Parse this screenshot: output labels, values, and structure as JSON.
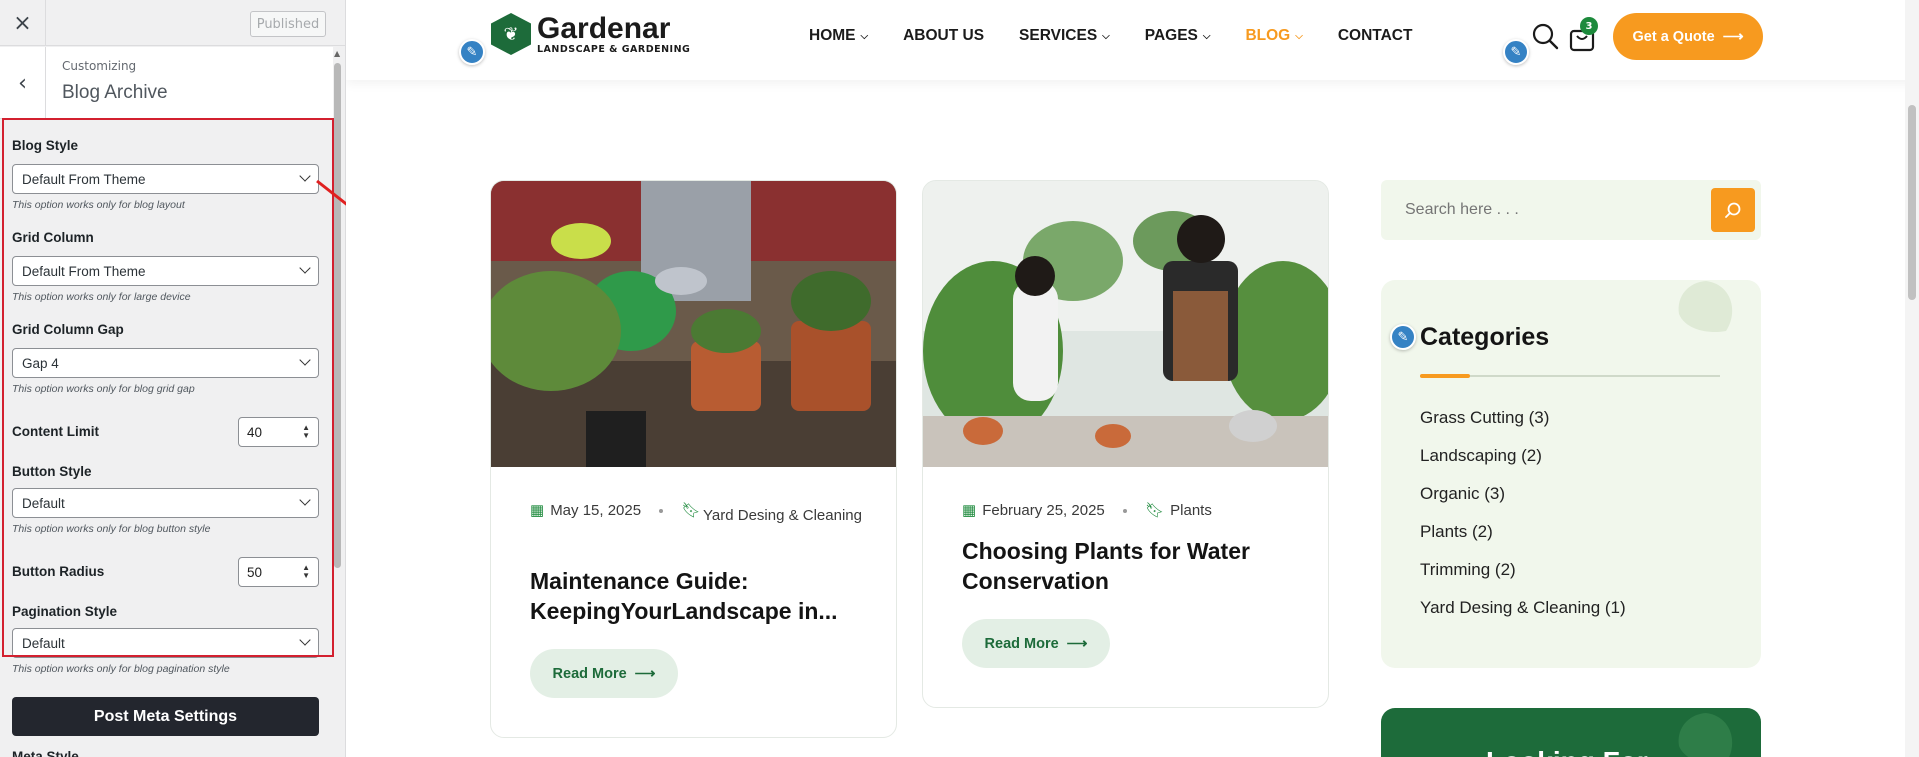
{
  "customizer": {
    "close_label": "×",
    "published_label": "Published",
    "breadcrumb": "Customizing",
    "section_title": "Blog Archive",
    "controls": {
      "blog_style": {
        "label": "Blog Style",
        "value": "Default From Theme",
        "hint": "This option works only for blog layout"
      },
      "grid_column": {
        "label": "Grid Column",
        "value": "Default From Theme",
        "hint": "This option works only for large device"
      },
      "grid_column_gap": {
        "label": "Grid Column Gap",
        "value": "Gap 4",
        "hint": "This option works only for blog grid gap"
      },
      "content_limit": {
        "label": "Content Limit",
        "value": "40"
      },
      "button_style": {
        "label": "Button Style",
        "value": "Default",
        "hint": "This option works only for blog button style"
      },
      "button_radius": {
        "label": "Button Radius",
        "value": "50"
      },
      "pagination_style": {
        "label": "Pagination Style",
        "value": "Default",
        "hint": "This option works only for blog pagination style"
      },
      "meta_style": {
        "label": "Meta Style"
      }
    },
    "post_meta_button": "Post Meta Settings"
  },
  "site": {
    "logo": {
      "name": "Gardenar",
      "tagline": "LANDSCAPE & GARDENING"
    },
    "nav": [
      {
        "label": "HOME",
        "dropdown": true,
        "active": false
      },
      {
        "label": "ABOUT US",
        "dropdown": false,
        "active": false
      },
      {
        "label": "SERVICES",
        "dropdown": true,
        "active": false
      },
      {
        "label": "PAGES",
        "dropdown": true,
        "active": false
      },
      {
        "label": "BLOG",
        "dropdown": true,
        "active": true
      },
      {
        "label": "CONTACT",
        "dropdown": false,
        "active": false
      }
    ],
    "cart_count": "3",
    "quote_button": "Get a Quote",
    "accent_color": "#f79a1f",
    "brand_green": "#1d6b3a"
  },
  "posts": [
    {
      "date": "May 15, 2025",
      "category": "Yard Desing & Cleaning",
      "title": "Maintenance Guide: KeepingYourLandscape in...",
      "read_more": "Read More"
    },
    {
      "date": "February 25, 2025",
      "category": "Plants",
      "title": "Choosing Plants for Water Conservation",
      "read_more": "Read More"
    }
  ],
  "sidebar": {
    "search_placeholder": "Search here . . .",
    "categories_title": "Categories",
    "categories": [
      "Grass Cutting (3)",
      "Landscaping (2)",
      "Organic (3)",
      "Plants (2)",
      "Trimming (2)",
      "Yard Desing & Cleaning (1)"
    ],
    "promo_partial_text": "Looking For"
  }
}
